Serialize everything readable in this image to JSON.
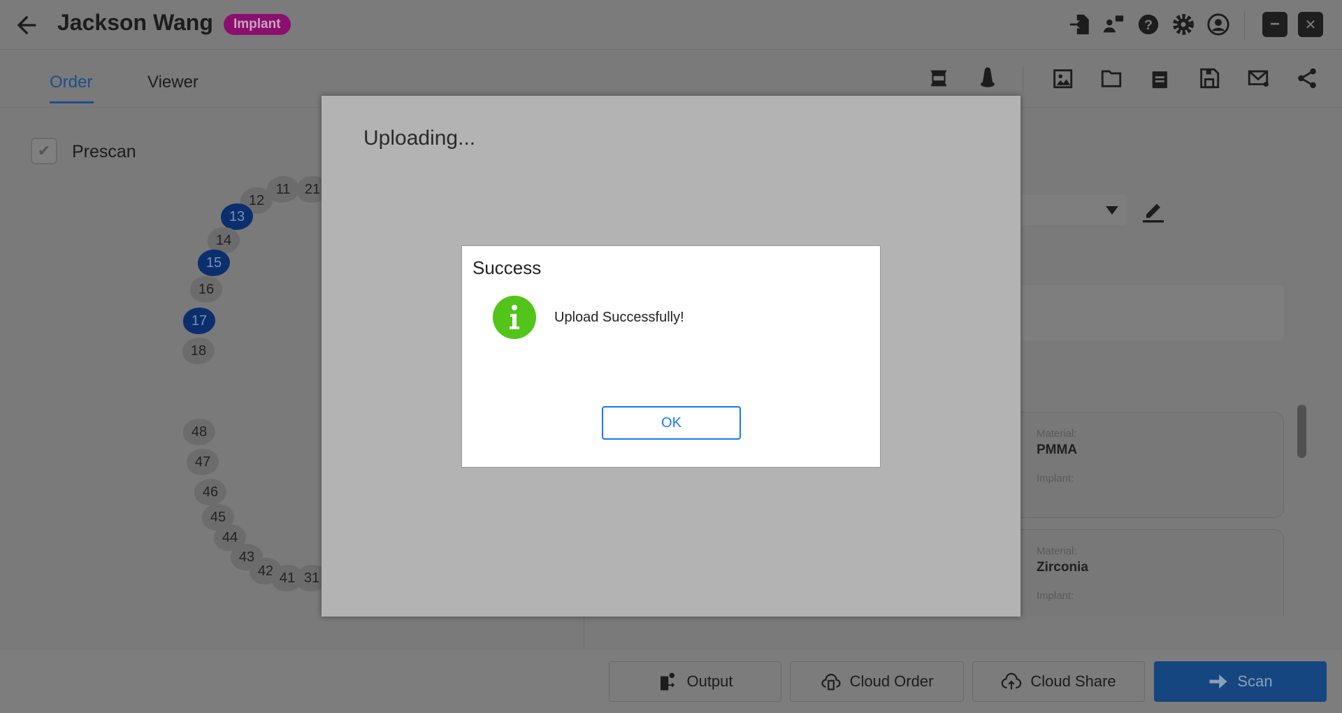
{
  "header": {
    "patient_name": "Jackson Wang",
    "badge": "Implant",
    "icons": [
      "import-icon",
      "chat-user-icon",
      "help-icon",
      "settings-icon",
      "account-icon"
    ],
    "window": {
      "minimize": "−",
      "close": "✕"
    }
  },
  "tabs": [
    {
      "label": "Order",
      "active": true
    },
    {
      "label": "Viewer",
      "active": false
    }
  ],
  "toolbar": {
    "icons": [
      "jaw-icon",
      "scanbody-icon",
      "gallery-icon",
      "folder-icon",
      "documents-icon",
      "save-icon",
      "mail-icon",
      "share-icon"
    ]
  },
  "prescan": {
    "label": "Prescan",
    "checked": true
  },
  "teeth": [
    {
      "n": "11",
      "sel": false
    },
    {
      "n": "21",
      "sel": false
    },
    {
      "n": "12",
      "sel": false
    },
    {
      "n": "13",
      "sel": true
    },
    {
      "n": "14",
      "sel": false
    },
    {
      "n": "15",
      "sel": true
    },
    {
      "n": "16",
      "sel": false
    },
    {
      "n": "17",
      "sel": true
    },
    {
      "n": "18",
      "sel": false
    },
    {
      "n": "48",
      "sel": false
    },
    {
      "n": "47",
      "sel": false
    },
    {
      "n": "46",
      "sel": false
    },
    {
      "n": "45",
      "sel": false
    },
    {
      "n": "44",
      "sel": false
    },
    {
      "n": "43",
      "sel": false
    },
    {
      "n": "42",
      "sel": false
    },
    {
      "n": "41",
      "sel": false
    },
    {
      "n": "31",
      "sel": false
    }
  ],
  "cards": [
    {
      "material_label": "Material:",
      "material": "PMMA",
      "implant_label": "Implant:"
    },
    {
      "material_label": "Material:",
      "material": "Zirconia",
      "implant_label": "Implant:"
    }
  ],
  "bottom": {
    "output": "Output",
    "cloud_order": "Cloud Order",
    "cloud_share": "Cloud Share",
    "scan": "Scan"
  },
  "uploading": {
    "title": "Uploading..."
  },
  "success": {
    "title": "Success",
    "message": "Upload Successfully!",
    "ok": "OK",
    "icon_color": "#52c41a"
  },
  "colors": {
    "accent": "#1677ff",
    "badge": "#8a0f6e",
    "selected_tooth": "#0b2f6e"
  }
}
